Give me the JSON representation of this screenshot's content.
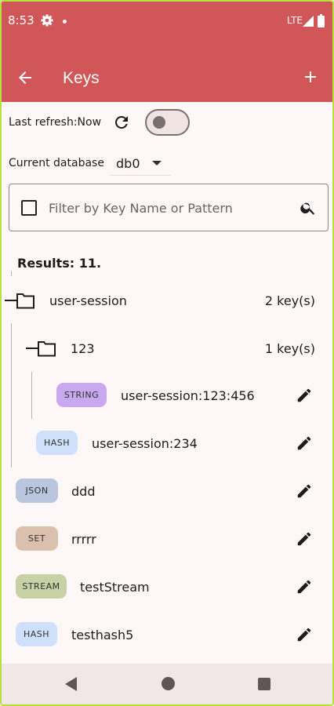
{
  "status_bar": {
    "time": "8:53",
    "network": "LTE"
  },
  "app_bar": {
    "title": "Keys"
  },
  "refresh": {
    "label": "Last refresh:Now"
  },
  "database": {
    "label": "Current database",
    "value": "db0"
  },
  "search": {
    "placeholder": "Filter by Key Name or Pattern",
    "value": ""
  },
  "results": {
    "text": "Results: 11."
  },
  "tree": {
    "folder1": {
      "label": "user-session",
      "count": "2 key(s)"
    },
    "folder2": {
      "label": "123",
      "count": "1 key(s)"
    },
    "keys": [
      {
        "type": "STRING",
        "name": "user-session:123:456"
      },
      {
        "type": "HASH",
        "name": "user-session:234"
      },
      {
        "type": "JSON",
        "name": "ddd"
      },
      {
        "type": "SET",
        "name": "rrrrr"
      },
      {
        "type": "STREAM",
        "name": "testStream"
      },
      {
        "type": "HASH",
        "name": "testhash5"
      }
    ]
  },
  "colors": {
    "primary": "#d05658",
    "string": "#c8a8ef",
    "hash": "#cfe0fb",
    "json": "#b9c6dd",
    "set": "#dcc0ae",
    "stream": "#c8d1a6"
  }
}
